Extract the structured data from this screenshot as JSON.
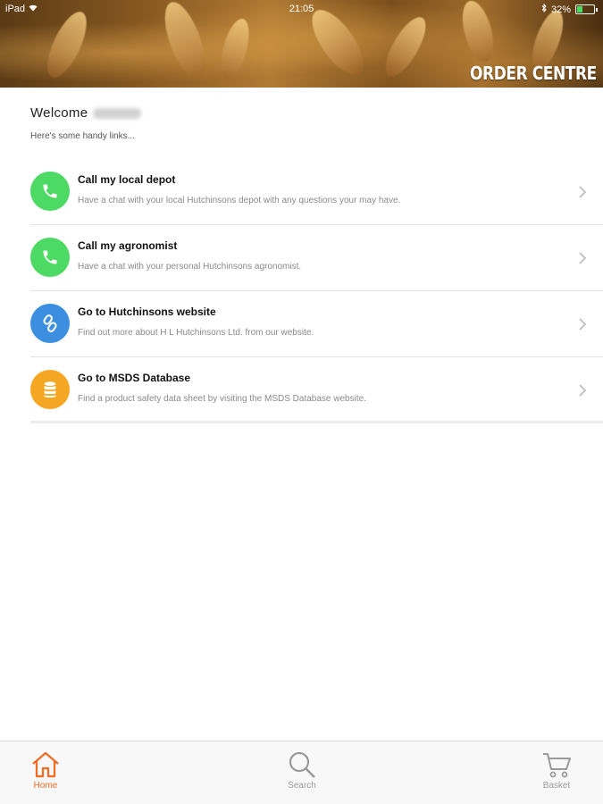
{
  "status_bar": {
    "carrier": "iPad",
    "time": "21:05",
    "battery": "32%",
    "battery_level": 0.32
  },
  "header": {
    "title": "ORDER CENTRE"
  },
  "welcome": {
    "greeting": "Welcome",
    "subtitle": "Here's some handy links..."
  },
  "links": [
    {
      "title": "Call my local depot",
      "description": "Have a chat with your local Hutchinsons depot with any questions your may have.",
      "icon": "phone-icon",
      "color": "#4cd964"
    },
    {
      "title": "Call my agronomist",
      "description": "Have a chat with your personal Hutchinsons agronomist.",
      "icon": "phone-icon",
      "color": "#4cd964"
    },
    {
      "title": "Go to Hutchinsons website",
      "description": "Find out more about H L Hutchinsons Ltd. from our website.",
      "icon": "link-icon",
      "color": "#3b8ee0"
    },
    {
      "title": "Go to MSDS Database",
      "description": "Find a product safety data sheet by visiting the MSDS Database website.",
      "icon": "database-icon",
      "color": "#f5a623"
    }
  ],
  "tab_bar": {
    "home": "Home",
    "search": "Search",
    "basket": "Basket",
    "active_color": "#f26b21",
    "inactive_color": "#9a9a9a"
  }
}
